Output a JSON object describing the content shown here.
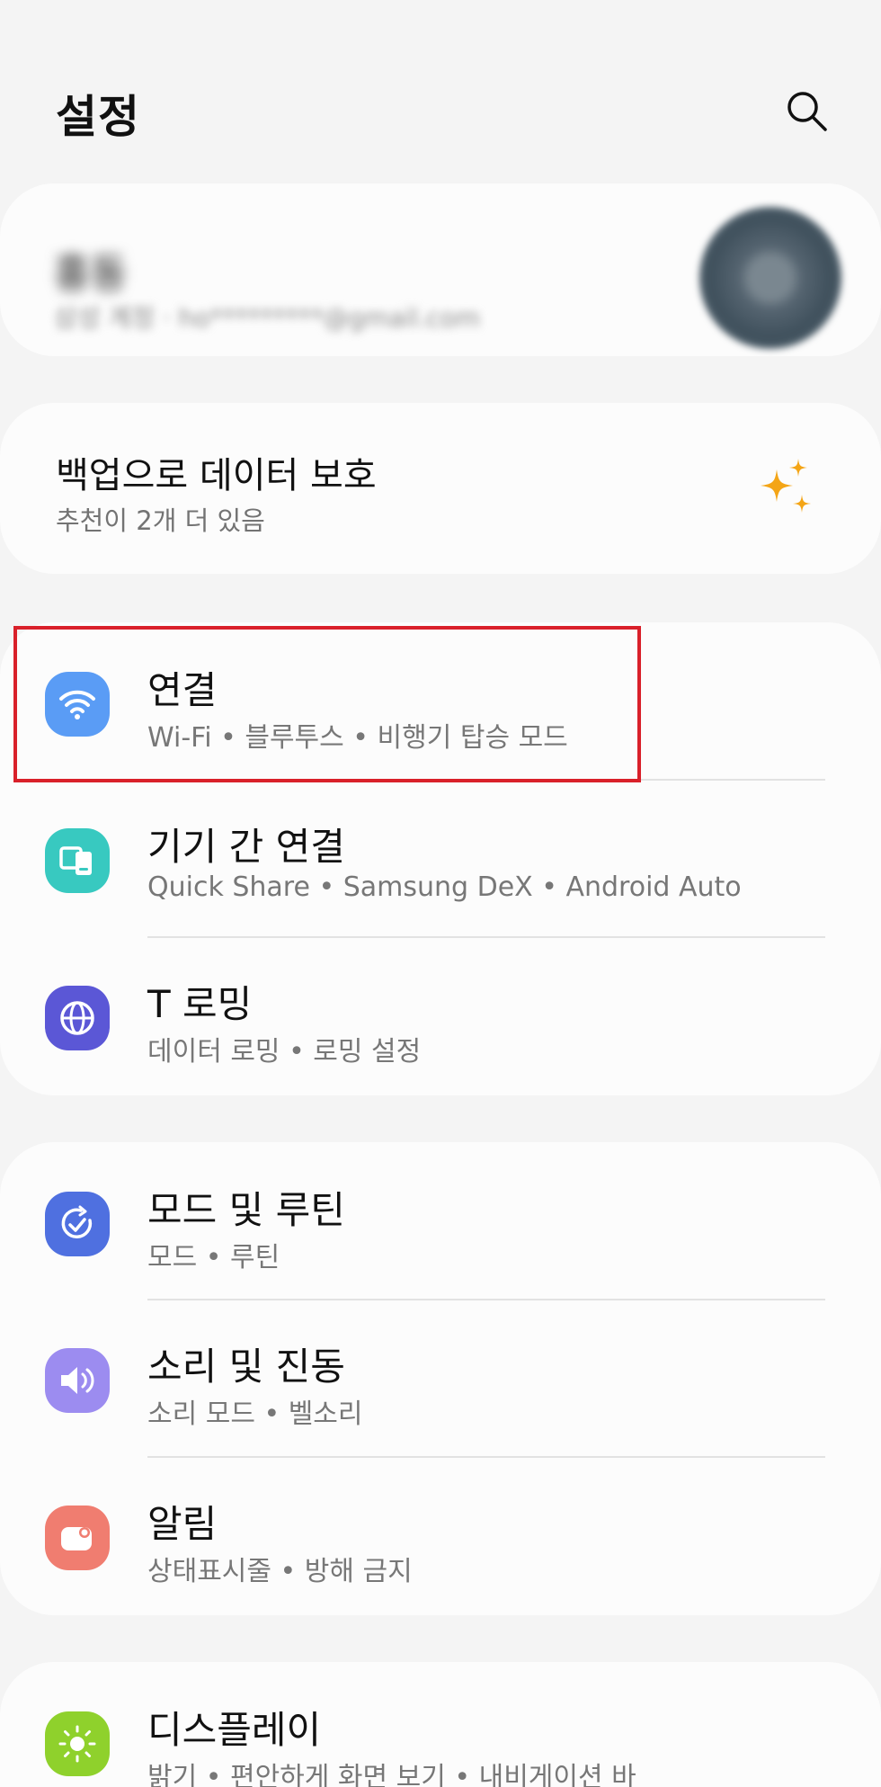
{
  "header": {
    "title": "설정"
  },
  "profile": {
    "name": "홍동",
    "account": "삼성 계정 · ho*********@gmail.com"
  },
  "backup_card": {
    "title": "백업으로 데이터 보호",
    "subtitle": "추천이 2개 더 있음"
  },
  "groups": [
    {
      "items": [
        {
          "label": "연결",
          "subtitle": "Wi-Fi  •  블루투스  •  비행기 탑승 모드",
          "icon": "wifi-icon",
          "color": "#5a9cf5"
        },
        {
          "label": "기기 간 연결",
          "subtitle": "Quick Share  •  Samsung DeX  •  Android Auto",
          "icon": "devices-icon",
          "color": "#38c9c0"
        },
        {
          "label": "T 로밍",
          "subtitle": "데이터 로밍  •  로밍 설정",
          "icon": "globe-icon",
          "color": "#5b57d6"
        }
      ]
    },
    {
      "items": [
        {
          "label": "모드 및 루틴",
          "subtitle": "모드  •  루틴",
          "icon": "modes-routines-icon",
          "color": "#4f70e0"
        },
        {
          "label": "소리 및 진동",
          "subtitle": "소리 모드  •  벨소리",
          "icon": "speaker-icon",
          "color": "#9c8cf0"
        },
        {
          "label": "알림",
          "subtitle": "상태표시줄  •  방해 금지",
          "icon": "notification-icon",
          "color": "#f07d70"
        }
      ]
    },
    {
      "items": [
        {
          "label": "디스플레이",
          "subtitle": "밝기  •  편안하게 화면 보기  •  내비게이션 바",
          "icon": "brightness-icon",
          "color": "#8fd12c"
        }
      ]
    }
  ],
  "accent_colors": {
    "highlight_border": "#d9202a",
    "sparkle": "#f4a516"
  }
}
